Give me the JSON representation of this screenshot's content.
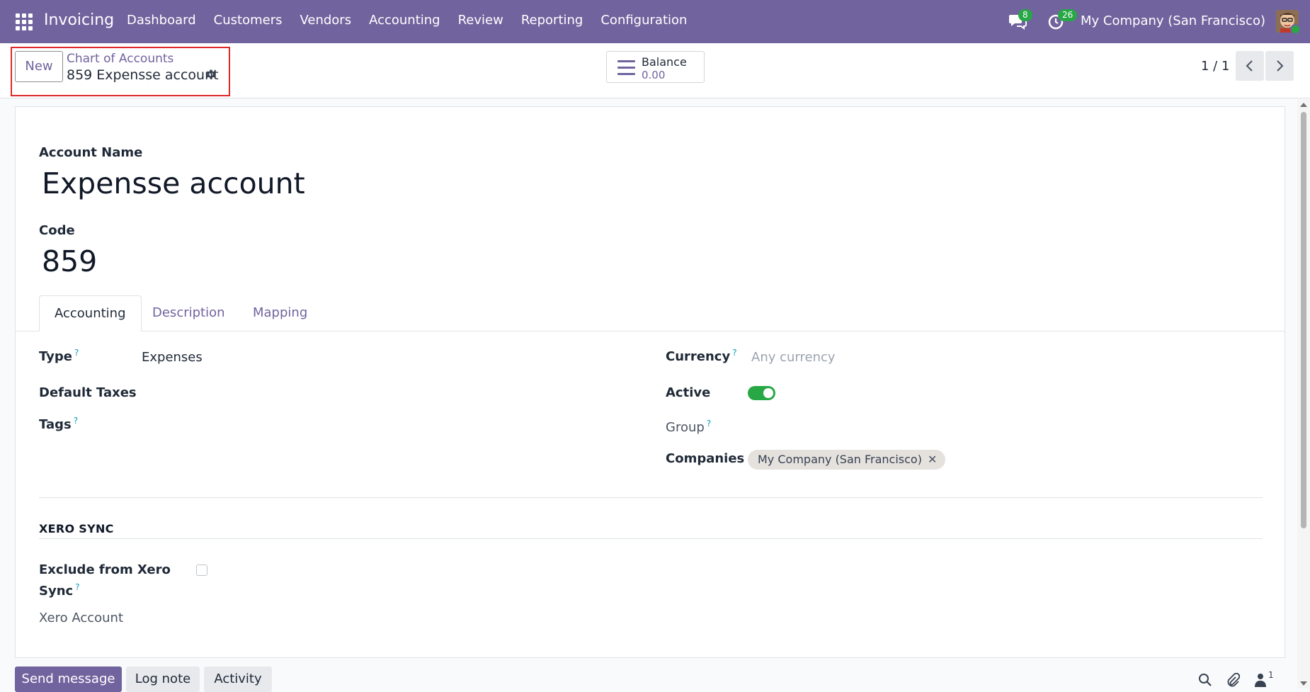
{
  "navbar": {
    "app_name": "Invoicing",
    "menu": [
      "Dashboard",
      "Customers",
      "Vendors",
      "Accounting",
      "Review",
      "Reporting",
      "Configuration"
    ],
    "messages_count": "8",
    "activities_count": "26",
    "company": "My Company (San Francisco)"
  },
  "control_panel": {
    "new_label": "New",
    "breadcrumb": "Chart of Accounts",
    "record_title": "859 Expensse account",
    "balance_label": "Balance",
    "balance_value": "0.00",
    "pager": "1 / 1"
  },
  "form": {
    "account_name_label": "Account Name",
    "account_name": "Expensse account",
    "code_label": "Code",
    "code": "859",
    "tabs": [
      "Accounting",
      "Description",
      "Mapping"
    ],
    "type_label": "Type",
    "type_help": "?",
    "type_value": "Expenses",
    "default_taxes_label": "Default Taxes",
    "tags_label": "Tags",
    "tags_help": "?",
    "currency_label": "Currency",
    "currency_help": "?",
    "currency_placeholder": "Any currency",
    "active_label": "Active",
    "active": true,
    "group_label": "Group",
    "group_help": "?",
    "companies_label": "Companies",
    "companies_tag": "My Company (San Francisco)",
    "xero_section": "XERO SYNC",
    "exclude_label_line1": "Exclude from Xero",
    "exclude_label_line2": "Sync",
    "exclude_help": "?",
    "xero_account_label": "Xero Account"
  },
  "chatter": {
    "send_message": "Send message",
    "log_note": "Log note",
    "activity": "Activity",
    "followers_count": "1"
  },
  "colors": {
    "brand": "#71639e",
    "success": "#28a745",
    "highlight": "#e0272a"
  }
}
